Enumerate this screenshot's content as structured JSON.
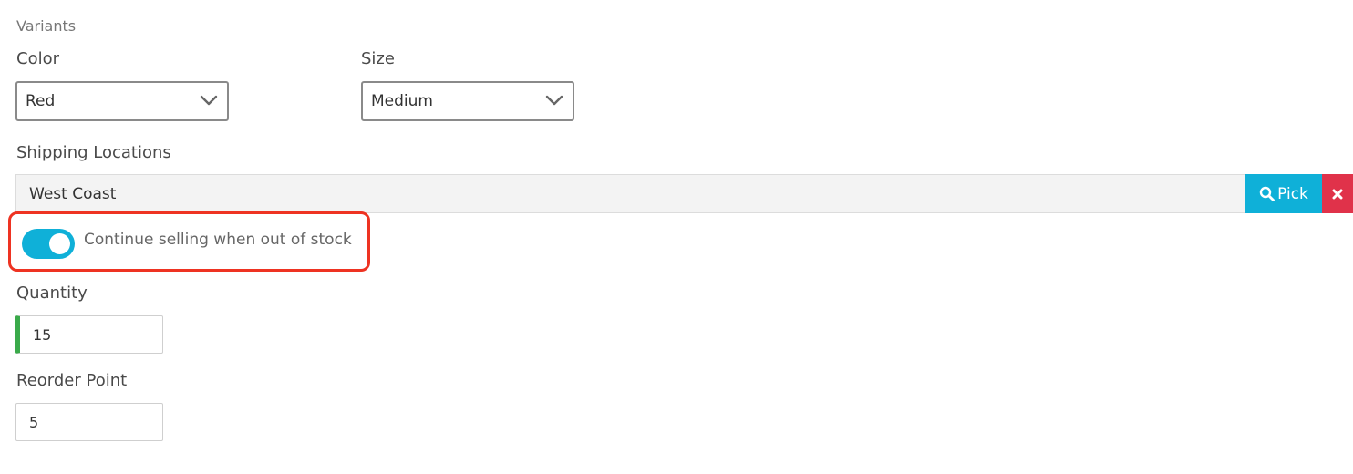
{
  "variants": {
    "heading": "Variants",
    "color": {
      "label": "Color",
      "value": "Red"
    },
    "size": {
      "label": "Size",
      "value": "Medium"
    }
  },
  "shipping": {
    "label": "Shipping Locations",
    "value": "West Coast",
    "pick_label": "Pick",
    "pick_color": "#0fb0d8",
    "clear_color": "#e0324a"
  },
  "continue_selling": {
    "label": "Continue selling when out of stock",
    "enabled": true,
    "highlight_color": "#ee3322"
  },
  "quantity": {
    "label": "Quantity",
    "value": "15",
    "status_color": "#3aaa4a"
  },
  "reorder_point": {
    "label": "Reorder Point",
    "value": "5"
  }
}
